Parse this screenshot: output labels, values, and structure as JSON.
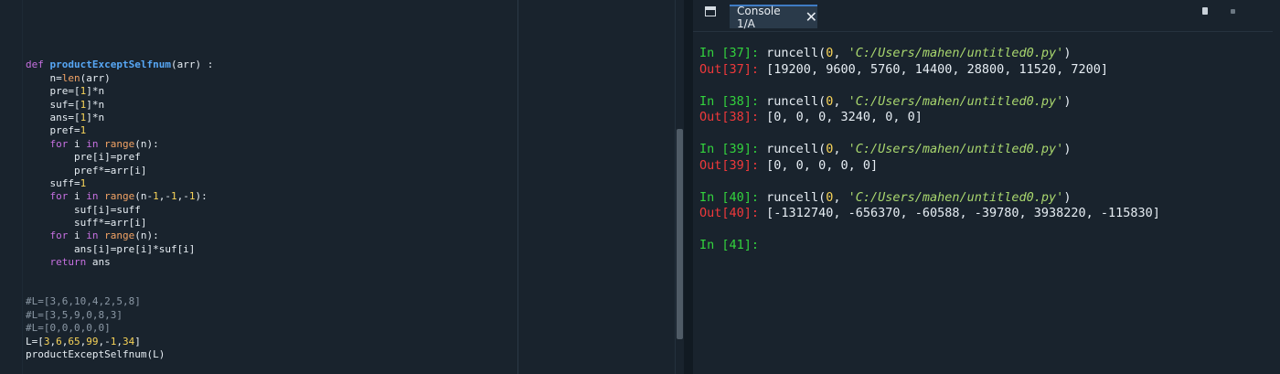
{
  "editor": {
    "lines": [
      [],
      [
        [
          "kw",
          "def "
        ],
        [
          "fn",
          "productExceptSelfnum"
        ],
        [
          "txt",
          "(arr) :"
        ]
      ],
      [
        [
          "txt",
          "    n="
        ],
        [
          "bi",
          "len"
        ],
        [
          "txt",
          "(arr)"
        ]
      ],
      [
        [
          "txt",
          "    pre=["
        ],
        [
          "num",
          "1"
        ],
        [
          "txt",
          "]*n"
        ]
      ],
      [
        [
          "txt",
          "    suf=["
        ],
        [
          "num",
          "1"
        ],
        [
          "txt",
          "]*n"
        ]
      ],
      [
        [
          "txt",
          "    ans=["
        ],
        [
          "num",
          "1"
        ],
        [
          "txt",
          "]*n"
        ]
      ],
      [
        [
          "txt",
          "    pref="
        ],
        [
          "num",
          "1"
        ]
      ],
      [
        [
          "txt",
          "    "
        ],
        [
          "kw",
          "for"
        ],
        [
          "txt",
          " i "
        ],
        [
          "kw",
          "in"
        ],
        [
          "txt",
          " "
        ],
        [
          "bi",
          "range"
        ],
        [
          "txt",
          "(n):"
        ]
      ],
      [
        [
          "txt",
          "        pre[i]=pref"
        ]
      ],
      [
        [
          "txt",
          "        pref*=arr[i]"
        ]
      ],
      [
        [
          "txt",
          "    suff="
        ],
        [
          "num",
          "1"
        ]
      ],
      [
        [
          "txt",
          "    "
        ],
        [
          "kw",
          "for"
        ],
        [
          "txt",
          " i "
        ],
        [
          "kw",
          "in"
        ],
        [
          "txt",
          " "
        ],
        [
          "bi",
          "range"
        ],
        [
          "txt",
          "(n-"
        ],
        [
          "num",
          "1"
        ],
        [
          "txt",
          ",-"
        ],
        [
          "num",
          "1"
        ],
        [
          "txt",
          ",-"
        ],
        [
          "num",
          "1"
        ],
        [
          "txt",
          "):"
        ]
      ],
      [
        [
          "txt",
          "        suf[i]=suff"
        ]
      ],
      [
        [
          "txt",
          "        suff*=arr[i]"
        ]
      ],
      [
        [
          "txt",
          "    "
        ],
        [
          "kw",
          "for"
        ],
        [
          "txt",
          " i "
        ],
        [
          "kw",
          "in"
        ],
        [
          "txt",
          " "
        ],
        [
          "bi",
          "range"
        ],
        [
          "txt",
          "(n):"
        ]
      ],
      [
        [
          "txt",
          "        ans[i]=pre[i]*suf[i]"
        ]
      ],
      [
        [
          "txt",
          "    "
        ],
        [
          "kw",
          "return"
        ],
        [
          "txt",
          " ans"
        ]
      ],
      [],
      [],
      [
        [
          "cm",
          "#L=[3,6,10,4,2,5,8]"
        ]
      ],
      [
        [
          "cm",
          "#L=[3,5,9,0,8,3]"
        ]
      ],
      [
        [
          "cm",
          "#L=[0,0,0,0,0]"
        ]
      ],
      [
        [
          "txt",
          "L=["
        ],
        [
          "num",
          "3"
        ],
        [
          "txt",
          ","
        ],
        [
          "num",
          "6"
        ],
        [
          "txt",
          ","
        ],
        [
          "num",
          "65"
        ],
        [
          "txt",
          ","
        ],
        [
          "num",
          "99"
        ],
        [
          "txt",
          ",-"
        ],
        [
          "num",
          "1"
        ],
        [
          "txt",
          ","
        ],
        [
          "num",
          "34"
        ],
        [
          "txt",
          "]"
        ]
      ],
      [
        [
          "txt",
          "productExceptSelfnum(L)"
        ]
      ]
    ]
  },
  "console": {
    "tab_label": "Console 1/A",
    "close_glyph": "✕",
    "entries": [
      {
        "in_prompt": "In [37]:",
        "call": "runcell(",
        "arg_num": "0",
        "sep": ", ",
        "arg_str": "'C:/Users/mahen/untitled0.py'",
        "close": ")",
        "out_prompt": "Out[37]:",
        "out_value": "[19200, 9600, 5760, 14400, 28800, 11520, 7200]"
      },
      {
        "in_prompt": "In [38]:",
        "call": "runcell(",
        "arg_num": "0",
        "sep": ", ",
        "arg_str": "'C:/Users/mahen/untitled0.py'",
        "close": ")",
        "out_prompt": "Out[38]:",
        "out_value": "[0, 0, 0, 3240, 0, 0]"
      },
      {
        "in_prompt": "In [39]:",
        "call": "runcell(",
        "arg_num": "0",
        "sep": ", ",
        "arg_str": "'C:/Users/mahen/untitled0.py'",
        "close": ")",
        "out_prompt": "Out[39]:",
        "out_value": "[0, 0, 0, 0, 0]"
      },
      {
        "in_prompt": "In [40]:",
        "call": "runcell(",
        "arg_num": "0",
        "sep": ", ",
        "arg_str": "'C:/Users/mahen/untitled0.py'",
        "close": ")",
        "out_prompt": "Out[40]:",
        "out_value": "[-1312740, -656370, -60588, -39780, 3938220, -115830]"
      }
    ],
    "current_prompt": "In [41]:"
  },
  "colors": {
    "background": "#19232d",
    "keyword": "#c670e0",
    "function_name": "#57a7f5",
    "builtin": "#f2a365",
    "number": "#f7d358",
    "comment": "#8b98a5",
    "in_prompt": "#33d33d",
    "out_prompt": "#f0393b",
    "string": "#a9d76e",
    "tab_accent": "#3f7cc4"
  },
  "icons": [
    "pane-icon",
    "close-icon",
    "options-icon"
  ]
}
